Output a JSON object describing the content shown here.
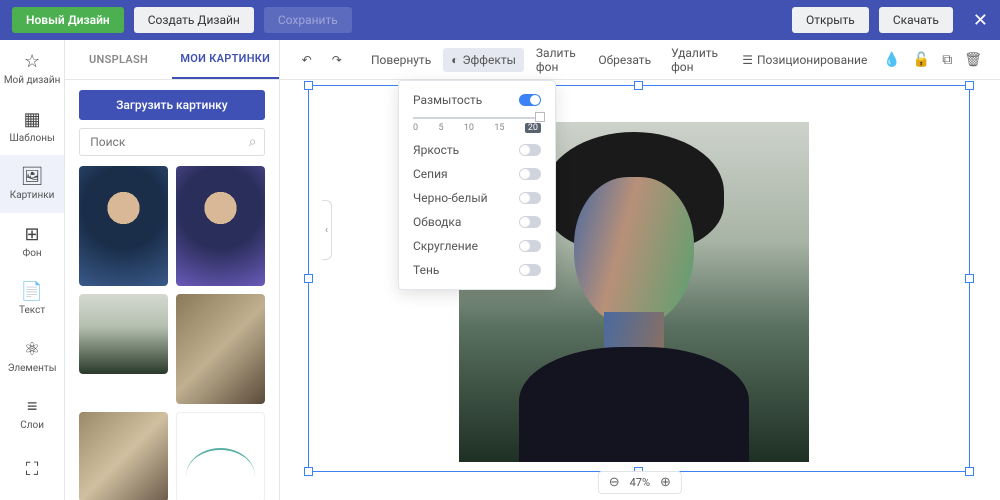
{
  "topbar": {
    "new_design": "Новый Дизайн",
    "create_design": "Создать Дизайн",
    "save": "Сохранить",
    "open": "Открыть",
    "download": "Скачать"
  },
  "leftnav": {
    "items": [
      {
        "icon": "☆",
        "label": "Мой дизайн"
      },
      {
        "icon": "▦",
        "label": "Шаблоны"
      },
      {
        "icon": "🖼",
        "label": "Картинки"
      },
      {
        "icon": "⊞",
        "label": "Фон"
      },
      {
        "icon": "📄",
        "label": "Текст"
      },
      {
        "icon": "⚛",
        "label": "Элементы"
      },
      {
        "icon": "≡",
        "label": "Слои"
      },
      {
        "icon": "⛶",
        "label": ""
      }
    ]
  },
  "sidepanel": {
    "tabs": [
      {
        "label": "UNSPLASH"
      },
      {
        "label": "МОИ КАРТИНКИ"
      }
    ],
    "upload": "Загрузить картинку",
    "search_placeholder": "Поиск"
  },
  "toolbar": {
    "undo_icon": "↶",
    "redo_icon": "↷",
    "rotate": "Повернуть",
    "effects": "Эффекты",
    "effects_icon": "◐",
    "flood_bg": "Залить фон",
    "crop": "Обрезать",
    "remove_bg": "Удалить фон",
    "positioning": "Позиционирование",
    "positioning_icon": "☰",
    "drop_icon": "💧",
    "lock_icon": "🔓",
    "copy_icon": "⧉",
    "delete_icon": "🗑"
  },
  "effects": {
    "blur": "Размытость",
    "brightness": "Яркость",
    "sepia": "Сепия",
    "bw": "Черно-белый",
    "stroke": "Обводка",
    "rounding": "Скругление",
    "shadow": "Тень",
    "slider": {
      "ticks": [
        "0",
        "5",
        "10",
        "15",
        "20"
      ],
      "value": "20"
    }
  },
  "zoom": {
    "value": "47%"
  }
}
